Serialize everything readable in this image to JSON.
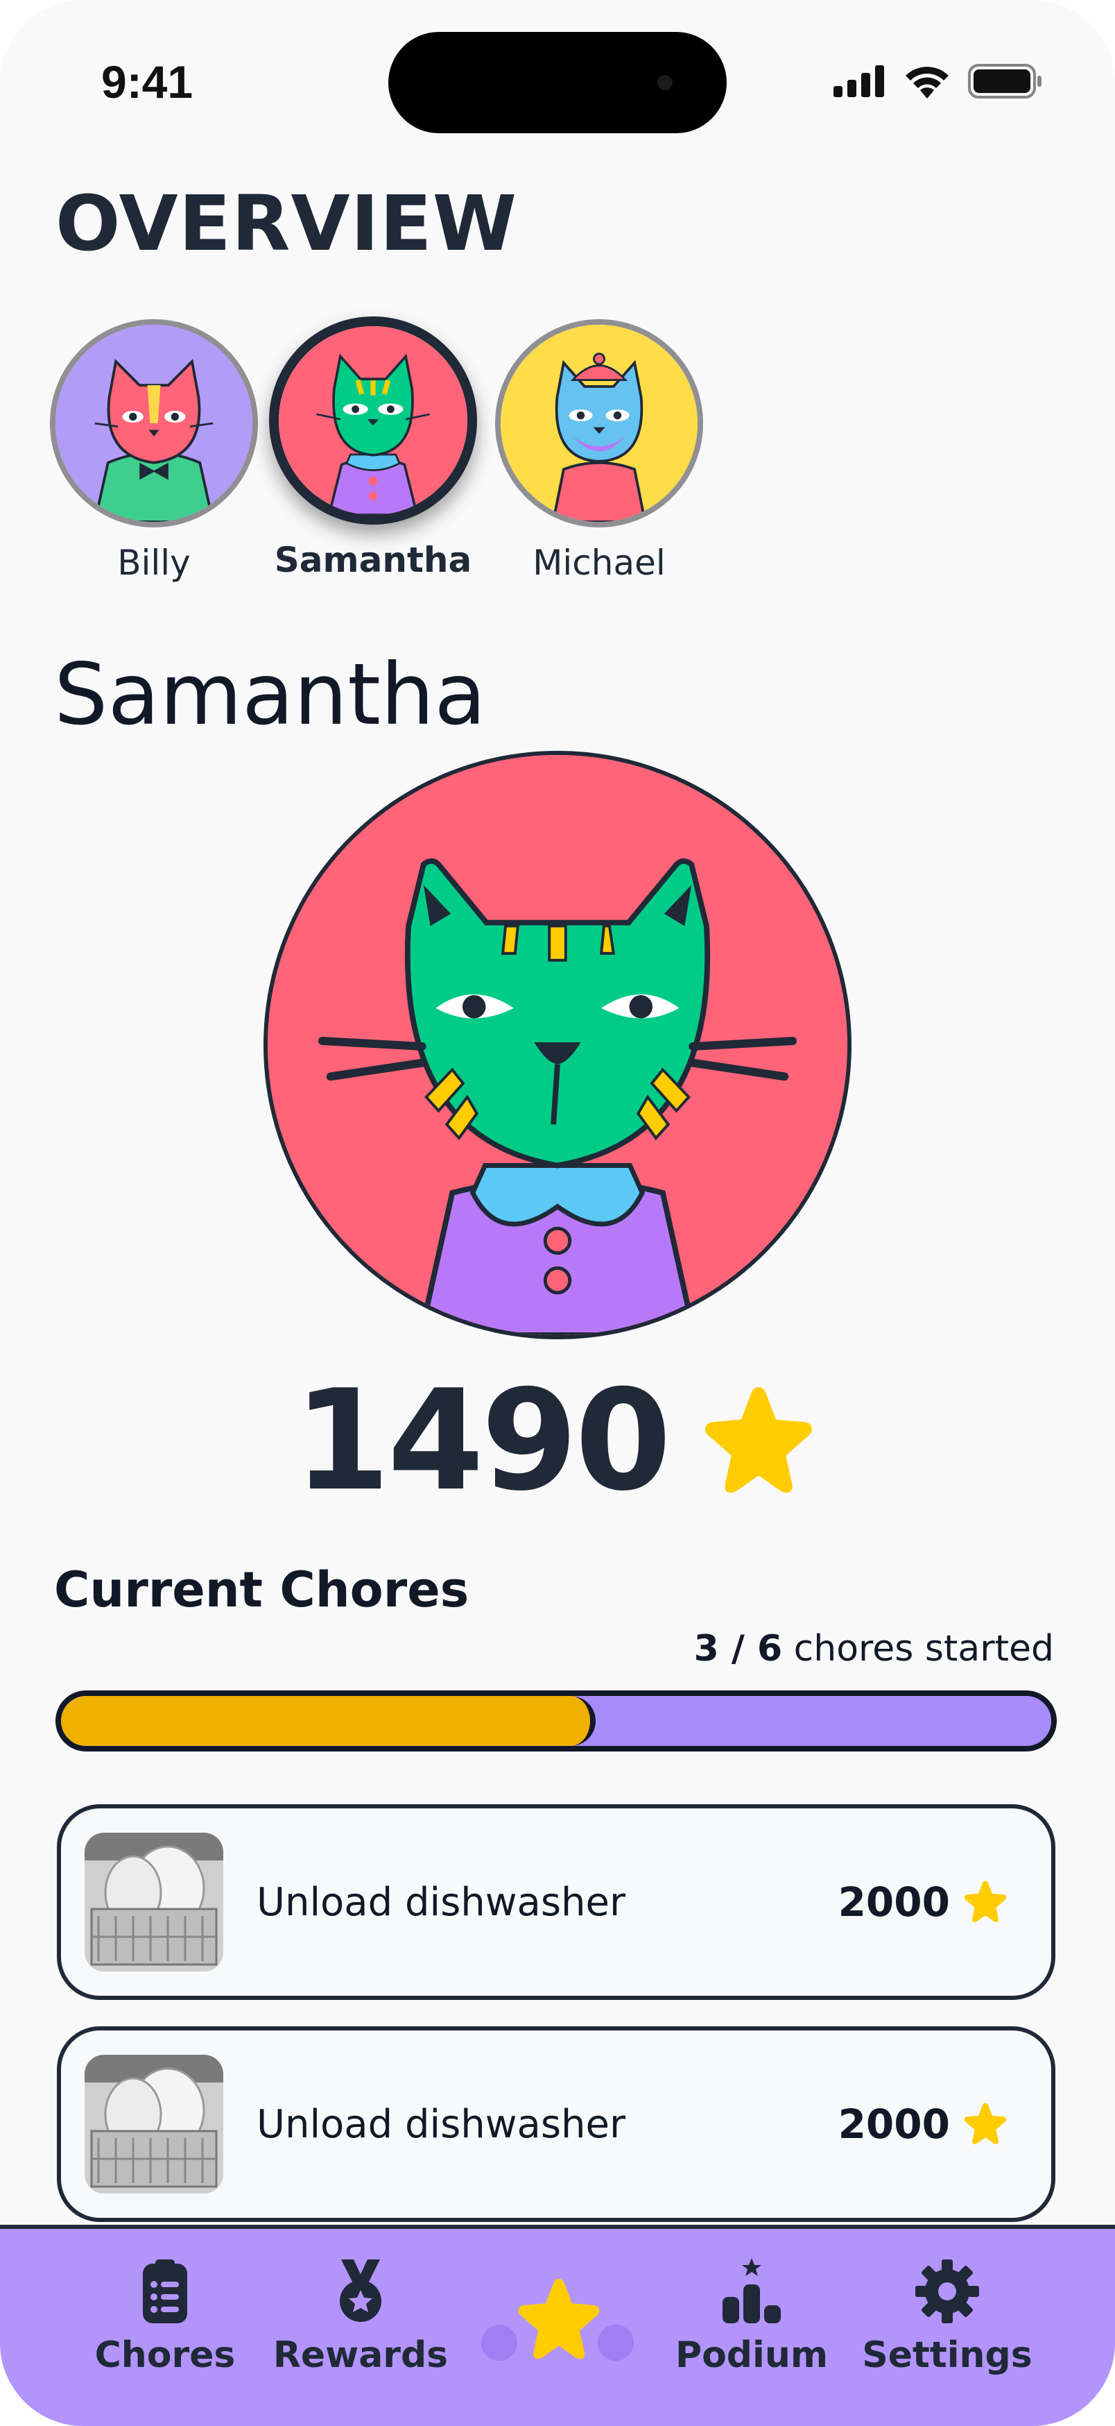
{
  "status_bar": {
    "time": "9:41"
  },
  "page_title": "OVERVIEW",
  "kids": [
    {
      "name": "Billy",
      "selected": false
    },
    {
      "name": "Samantha",
      "selected": true
    },
    {
      "name": "Michael",
      "selected": false
    }
  ],
  "selected_kid": {
    "name": "Samantha",
    "points": "1490"
  },
  "chores_section": {
    "title": "Current Chores",
    "started_count": "3 / 6",
    "started_label": "chores started",
    "progress_fraction": 0.54,
    "items": [
      {
        "label": "Unload dishwasher",
        "points": "2000"
      },
      {
        "label": "Unload dishwasher",
        "points": "2000"
      }
    ]
  },
  "tab_bar": {
    "tabs": [
      {
        "label": "Chores",
        "icon": "clipboard-list-icon"
      },
      {
        "label": "Rewards",
        "icon": "medal-icon"
      },
      {
        "label": "",
        "icon": "star-icon"
      },
      {
        "label": "Podium",
        "icon": "podium-icon"
      },
      {
        "label": "Settings",
        "icon": "gear-icon"
      }
    ]
  },
  "colors": {
    "accent_purple": "#b394fb",
    "progress_gold": "#f0b000",
    "star_yellow": "#ffcc00",
    "dark": "#1f2937"
  }
}
